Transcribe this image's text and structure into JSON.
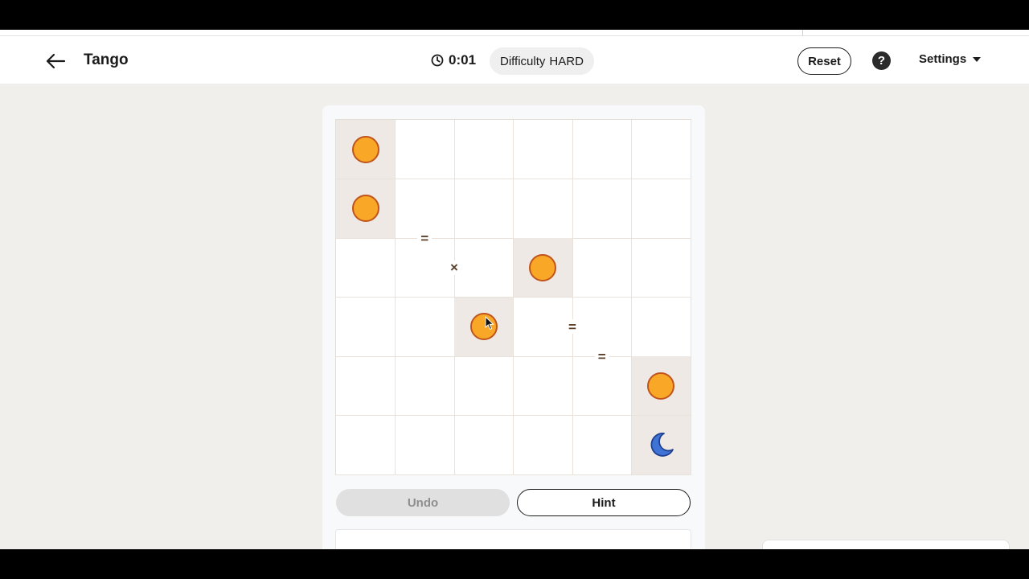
{
  "app": {
    "title": "Tango"
  },
  "header": {
    "timer": "0:01",
    "difficulty_label": "Difficulty",
    "difficulty_value": "HARD",
    "reset_label": "Reset",
    "help_label": "?",
    "settings_label": "Settings"
  },
  "board": {
    "rows": 6,
    "cols": 6,
    "cells": [
      [
        "sun",
        "",
        "",
        "",
        "",
        ""
      ],
      [
        "sun",
        "",
        "",
        "",
        "",
        ""
      ],
      [
        "",
        "",
        "",
        "sun",
        "",
        ""
      ],
      [
        "",
        "",
        "sun",
        "",
        "",
        ""
      ],
      [
        "",
        "",
        "",
        "",
        "",
        "sun"
      ],
      [
        "",
        "",
        "",
        "",
        "",
        "moon"
      ]
    ],
    "locked": [
      [
        0,
        0
      ],
      [
        1,
        0
      ],
      [
        2,
        3
      ],
      [
        3,
        2
      ],
      [
        4,
        5
      ],
      [
        5,
        5
      ]
    ],
    "constraints": [
      {
        "type": "=",
        "between": [
          [
            1,
            1
          ],
          [
            2,
            1
          ]
        ]
      },
      {
        "type": "×",
        "between": [
          [
            2,
            1
          ],
          [
            2,
            2
          ]
        ]
      },
      {
        "type": "=",
        "between": [
          [
            3,
            3
          ],
          [
            3,
            4
          ]
        ]
      },
      {
        "type": "=",
        "between": [
          [
            3,
            4
          ],
          [
            4,
            4
          ]
        ]
      }
    ]
  },
  "controls": {
    "undo_label": "Undo",
    "undo_enabled": false,
    "hint_label": "Hint"
  },
  "colors": {
    "sun_fill": "#f9a727",
    "sun_stroke": "#c0541c",
    "moon_fill": "#3f73d6",
    "locked_cell": "#efe9e5"
  },
  "icons": {
    "back": "arrow-left-icon",
    "timer": "clock-icon",
    "help": "question-circle-icon",
    "settings": "chevron-down-icon",
    "sun": "sun-icon",
    "moon": "moon-icon"
  }
}
